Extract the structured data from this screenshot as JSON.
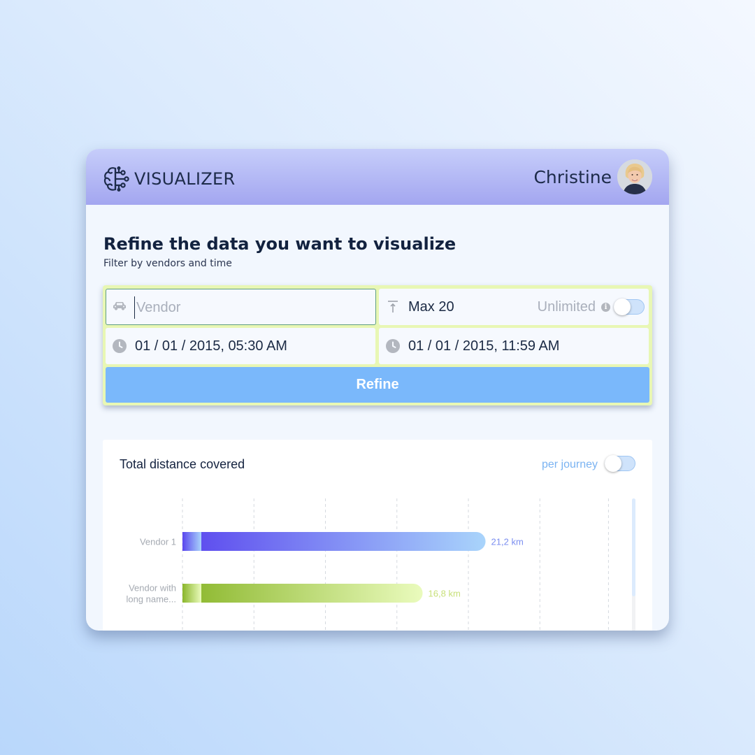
{
  "header": {
    "app_name": "VISUALIZER",
    "logo_icon": "brain-circuit-icon",
    "user_name": "Christine",
    "avatar_icon": "user-avatar"
  },
  "intro": {
    "title": "Refine the data you want to visualize",
    "subtitle": "Filter by vendors and time"
  },
  "filters": {
    "vendor": {
      "icon": "car-icon",
      "value": "",
      "placeholder": "Vendor"
    },
    "limit": {
      "icon": "arrow-up-to-line-icon",
      "value": "Max 20",
      "unlimited_label": "Unlimited",
      "info_icon": "info-icon",
      "unlimited_enabled": false
    },
    "start": {
      "icon": "clock-icon",
      "value": "01 / 01 / 2015, 05:30 AM"
    },
    "end": {
      "icon": "clock-icon",
      "value": "01 / 01 / 2015, 11:59 AM"
    },
    "submit_label": "Refine"
  },
  "colors": {
    "header_gradient": [
      "#c6cdfa",
      "#a3a6f0"
    ],
    "panel_accent": "#e8f7b4",
    "button": "#7ab8fb",
    "series_1_gradient": [
      "#5a46ee",
      "#a9d4fb"
    ],
    "series_2_gradient": [
      "#8ab62a",
      "#eafbbd"
    ]
  },
  "chart": {
    "title": "Total distance covered",
    "per_journey_label": "per journey",
    "per_journey_enabled": false
  },
  "chart_data": {
    "type": "bar",
    "orientation": "horizontal",
    "title": "Total distance covered",
    "categories": [
      "Vendor 1",
      "Vendor with long name..."
    ],
    "category_label_lines": [
      [
        "Vendor 1"
      ],
      [
        "Vendor with",
        "long name..."
      ]
    ],
    "values": [
      21.2,
      16.8
    ],
    "value_labels": [
      "21,2 km",
      "16,8 km"
    ],
    "unit": "km",
    "xlim": [
      0,
      31.2
    ],
    "grid": true,
    "gridlines_x": [
      0,
      5,
      10,
      15,
      20,
      25,
      29.8
    ]
  }
}
